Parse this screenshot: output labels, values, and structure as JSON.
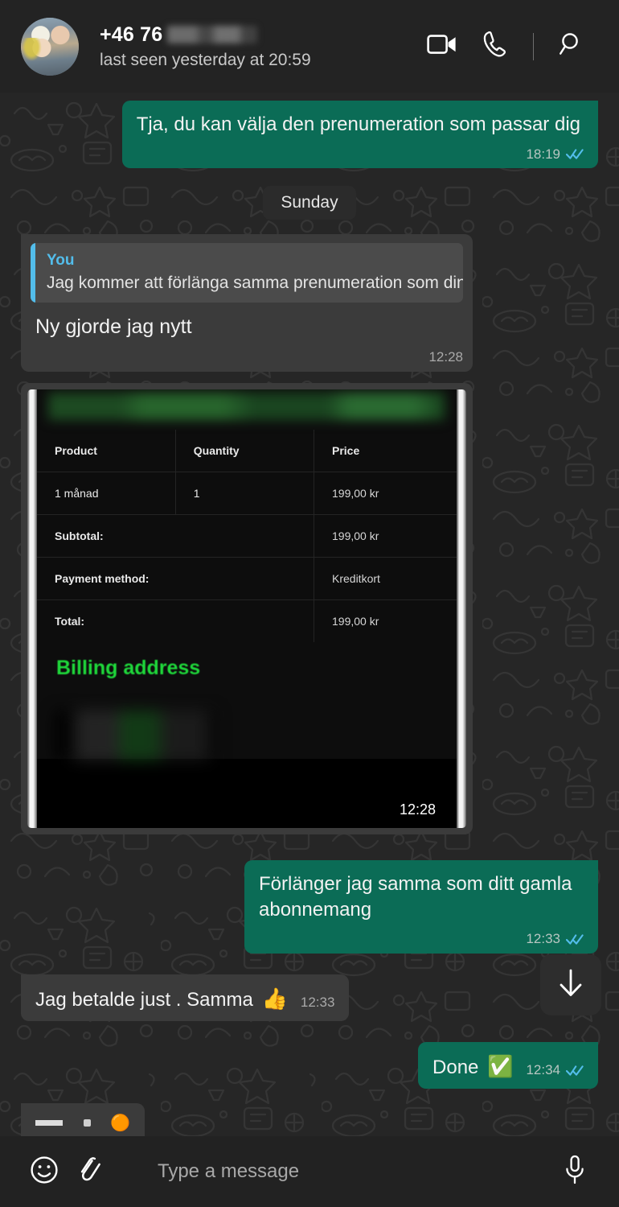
{
  "header": {
    "phone_number": "+46 76",
    "number_redacted": true,
    "status": "last seen yesterday at 20:59",
    "avatar_name": "contact-photo",
    "actions": [
      {
        "name": "video-call-icon",
        "label": "Video call"
      },
      {
        "name": "voice-call-icon",
        "label": "Voice call"
      },
      {
        "name": "search-icon",
        "label": "Search"
      }
    ]
  },
  "messages": [
    {
      "id": "m1",
      "direction": "out",
      "text": "Tja, du kan välja den prenumeration som passar dig",
      "time": "18:19",
      "status": "read"
    },
    {
      "id": "daychip",
      "type": "day-divider",
      "text": "Sunday"
    },
    {
      "id": "m2",
      "direction": "in",
      "quote": {
        "author": "You",
        "text": "Jag kommer att förlänga samma prenumeration som din"
      },
      "text": "Ny gjorde jag nytt",
      "time": "12:28"
    },
    {
      "id": "m3",
      "direction": "in",
      "type": "image",
      "time": "12:28",
      "invoice": {
        "header_redacted": true,
        "columns": [
          "Product",
          "Quantity",
          "Price"
        ],
        "rows": [
          {
            "product": "1 månad",
            "quantity": "1",
            "price": "199,00 kr"
          }
        ],
        "summary": [
          {
            "label": "Subtotal:",
            "value": "199,00 kr"
          },
          {
            "label": "Payment method:",
            "value": "Kreditkort"
          },
          {
            "label": "Total:",
            "value": "199,00 kr"
          }
        ],
        "billing_heading": "Billing address",
        "billing_redacted": true
      }
    },
    {
      "id": "m4",
      "direction": "out",
      "text": "Förlänger jag samma som ditt gamla abonnemang",
      "time": "12:33",
      "status": "read"
    },
    {
      "id": "m5",
      "direction": "in",
      "text": "Jag betalde just . Samma ",
      "emoji": "👍",
      "time": "12:33"
    },
    {
      "id": "m6",
      "direction": "out",
      "text": "Done ",
      "emoji": "✅",
      "time": "12:34",
      "status": "read"
    }
  ],
  "scroll_button": {
    "name": "scroll-to-bottom",
    "glyph": "↓"
  },
  "composer": {
    "placeholder": "Type a message",
    "value": "",
    "emoji_button": "emoji-icon",
    "attach_button": "attach-icon",
    "mic_button": "microphone-icon"
  },
  "colors": {
    "outgoing_bubble": "#0b6c56",
    "incoming_bubble": "#3b3b3b",
    "chat_background": "#262626",
    "header_background": "#232323",
    "read_tick": "#53bdeb",
    "quote_accent": "#53bdeb",
    "billing_green": "#1fd93b"
  }
}
